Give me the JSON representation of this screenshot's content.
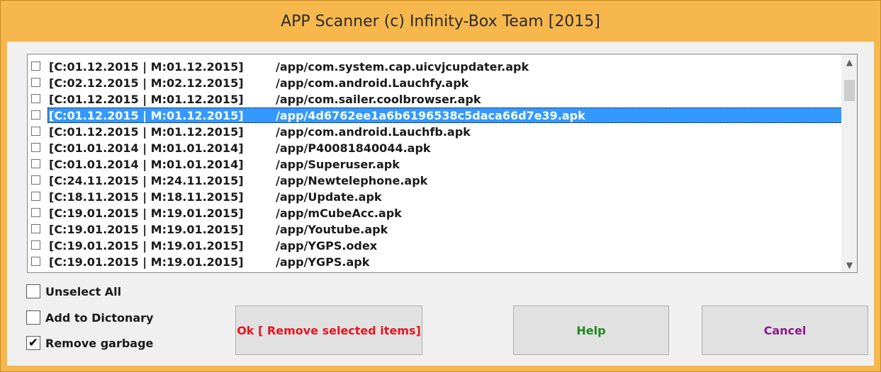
{
  "window": {
    "title": "APP Scanner (c) Infinity-Box Team [2015]"
  },
  "list": {
    "items": [
      {
        "dates": "[C:01.12.2015 | M:01.12.2015]",
        "path": "/app/com.system.cap.uicvjcupdater.apk",
        "checked": false,
        "selected": false
      },
      {
        "dates": "[C:02.12.2015 | M:02.12.2015]",
        "path": "/app/com.android.Lauchfy.apk",
        "checked": false,
        "selected": false
      },
      {
        "dates": "[C:01.12.2015 | M:01.12.2015]",
        "path": "/app/com.sailer.coolbrowser.apk",
        "checked": false,
        "selected": false
      },
      {
        "dates": "[C:01.12.2015 | M:01.12.2015]",
        "path": "/app/4d6762ee1a6b6196538c5daca66d7e39.apk",
        "checked": false,
        "selected": true
      },
      {
        "dates": "[C:01.12.2015 | M:01.12.2015]",
        "path": "/app/com.android.Lauchfb.apk",
        "checked": false,
        "selected": false
      },
      {
        "dates": "[C:01.01.2014 | M:01.01.2014]",
        "path": "/app/P40081840044.apk",
        "checked": false,
        "selected": false
      },
      {
        "dates": "[C:01.01.2014 | M:01.01.2014]",
        "path": "/app/Superuser.apk",
        "checked": false,
        "selected": false
      },
      {
        "dates": "[C:24.11.2015 | M:24.11.2015]",
        "path": "/app/Newtelephone.apk",
        "checked": false,
        "selected": false
      },
      {
        "dates": "[C:18.11.2015 | M:18.11.2015]",
        "path": "/app/Update.apk",
        "checked": false,
        "selected": false
      },
      {
        "dates": "[C:19.01.2015 | M:19.01.2015]",
        "path": "/app/mCubeAcc.apk",
        "checked": false,
        "selected": false
      },
      {
        "dates": "[C:19.01.2015 | M:19.01.2015]",
        "path": "/app/Youtube.apk",
        "checked": false,
        "selected": false
      },
      {
        "dates": "[C:19.01.2015 | M:19.01.2015]",
        "path": "/app/YGPS.odex",
        "checked": false,
        "selected": false
      },
      {
        "dates": "[C:19.01.2015 | M:19.01.2015]",
        "path": "/app/YGPS.apk",
        "checked": false,
        "selected": false
      }
    ],
    "scroll_up_icon": "chevron-up-icon",
    "scroll_down_icon": "chevron-down-icon"
  },
  "options": {
    "unselect_all": {
      "label": "Unselect All",
      "checked": false
    },
    "add_to_dictionary": {
      "label": "Add to Dictonary",
      "checked": false
    },
    "remove_garbage": {
      "label": "Remove garbage",
      "checked": true
    }
  },
  "buttons": {
    "ok": {
      "label": "Ok [ Remove selected items]",
      "color": "#e8141e"
    },
    "help": {
      "label": "Help",
      "color": "#1d8a1d"
    },
    "cancel": {
      "label": "Cancel",
      "color": "#8b1a8b"
    }
  },
  "colors": {
    "title_bar": "#f6b74c",
    "selection": "#3399ff"
  }
}
